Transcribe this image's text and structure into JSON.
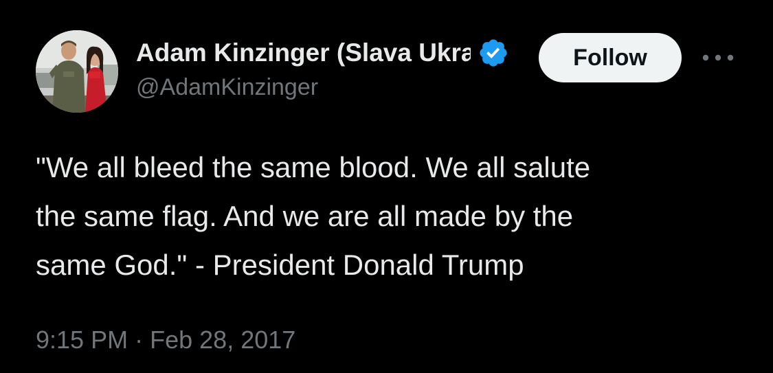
{
  "author": {
    "display_name": "Adam Kinzinger (Slava Ukraini)",
    "handle": "@AdamKinzinger",
    "verified": true,
    "avatar_icon": "avatar-photo"
  },
  "actions": {
    "follow_label": "Follow",
    "more_icon": "more-horizontal-icon"
  },
  "tweet": {
    "text": "\"We all bleed the same blood. We all salute\nthe same flag. And we are all made by the\nsame God.\" - President Donald Trump",
    "time": "9:15 PM",
    "separator": "·",
    "date": "Feb 28, 2017"
  },
  "colors": {
    "background": "#000000",
    "primary_text": "#e7e9ea",
    "secondary_text": "#71767b",
    "verified_blue": "#1d9bf0",
    "follow_bg": "#eff3f4"
  }
}
